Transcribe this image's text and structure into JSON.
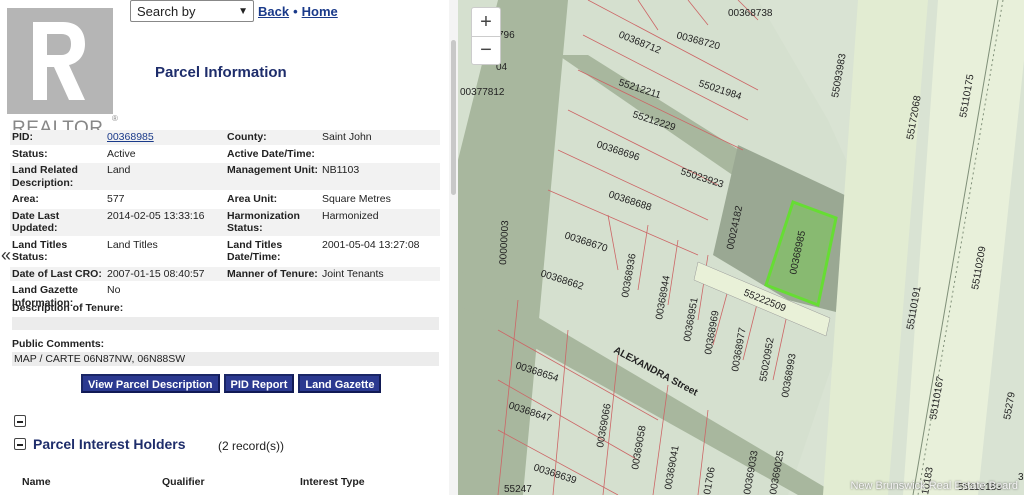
{
  "topbar": {
    "search_label": "Search by",
    "back_label": "Back",
    "home_label": "Home",
    "bullet": "•"
  },
  "logo": {
    "wordmark": "REALTOR",
    "reg": "®"
  },
  "panel": {
    "title": "Parcel Information"
  },
  "fields": [
    [
      {
        "label": "PID:",
        "value": "00368985"
      },
      {
        "label": "County:",
        "value": "Saint John"
      }
    ],
    [
      {
        "label": "Status:",
        "value": "Active"
      },
      {
        "label": "Active Date/Time:",
        "value": ""
      }
    ],
    [
      {
        "label": "Land Related Description:",
        "value": "Land"
      },
      {
        "label": "Management Unit:",
        "value": "NB1103"
      }
    ],
    [
      {
        "label": "Area:",
        "value": "577"
      },
      {
        "label": "Area Unit:",
        "value": "Square Metres"
      }
    ],
    [
      {
        "label": "Date Last Updated:",
        "value": "2014-02-05 13:33:16"
      },
      {
        "label": "Harmonization Status:",
        "value": "Harmonized"
      }
    ],
    [
      {
        "label": "Land Titles Status:",
        "value": "Land Titles"
      },
      {
        "label": "Land Titles Date/Time:",
        "value": "2001-05-04 13:27:08"
      }
    ],
    [
      {
        "label": "Date of Last CRO:",
        "value": "2007-01-15 08:40:57"
      },
      {
        "label": "Manner of Tenure:",
        "value": "Joint Tenants"
      }
    ],
    [
      {
        "label": "Land Gazette Information:",
        "value": "No"
      },
      {
        "label": "",
        "value": ""
      }
    ]
  ],
  "tenure": {
    "label": "Description of Tenure:",
    "value": ""
  },
  "comments": {
    "label": "Public Comments:",
    "value": "MAP / CARTE 06N87NW, 06N88SW"
  },
  "buttons": {
    "view_desc": "View Parcel Description",
    "pid_report": "PID Report",
    "land_gazette": "Land Gazette"
  },
  "interest": {
    "title": "Parcel Interest Holders",
    "count": "(2 record(s))",
    "columns": [
      "Name",
      "Qualifier",
      "Interest Type"
    ]
  },
  "map": {
    "zoom_in": "+",
    "zoom_out": "−",
    "street": "ALEXANDRA Street",
    "watermark": "New Brunswick Real Estate Board",
    "highlight_color": "#66dd33",
    "parcels": [
      "00368738",
      "00368712",
      "00368720",
      "55021984",
      "55212211",
      "55212229",
      "00368696",
      "55023923",
      "00368688",
      "00368670",
      "00368662",
      "00368936",
      "00368944",
      "00368951",
      "00368969",
      "00368977",
      "55020952",
      "00368993",
      "00368654",
      "00368647",
      "00369066",
      "00369058",
      "00369041",
      "00368639",
      "00024182",
      "00368985",
      "55222509",
      "55093983",
      "55172068",
      "55110175",
      "55110191",
      "55110209",
      "55110167",
      "00000003",
      "00377812"
    ],
    "edge_labels": [
      "796",
      "04",
      "55279",
      "3",
      "01706",
      "00369033",
      "00369025",
      "55247",
      "10183",
      "55110183"
    ]
  }
}
